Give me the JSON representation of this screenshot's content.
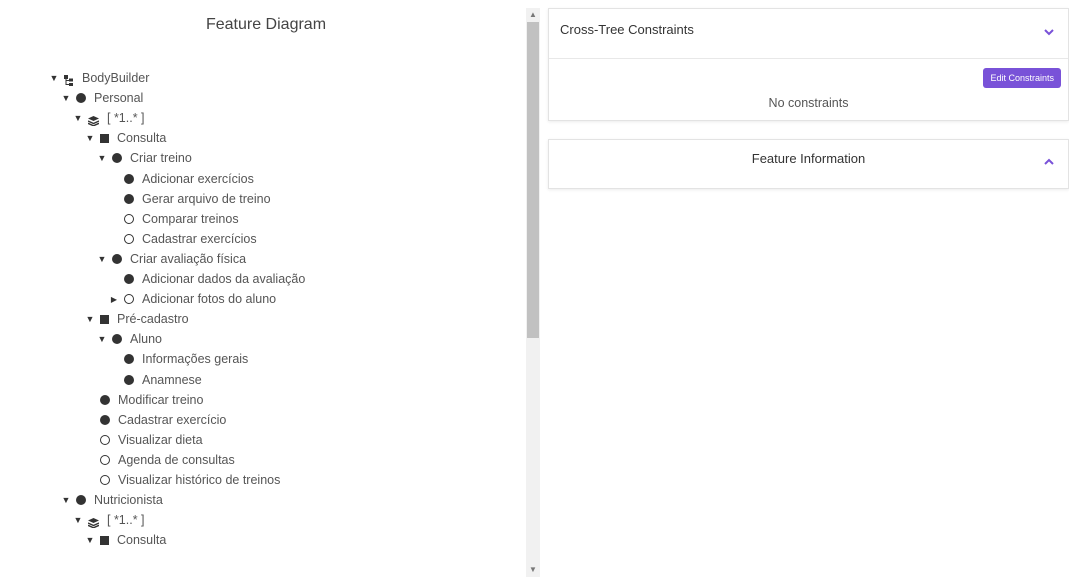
{
  "left_panel": {
    "title": "Feature Diagram",
    "tree": [
      {
        "label": "BodyBuilder",
        "icon": "tree-icon",
        "caret": "down",
        "level": 0
      },
      {
        "label": "Personal",
        "icon": "filled-circle",
        "caret": "down",
        "level": 1
      },
      {
        "label": "[ *1..* ]",
        "icon": "layers-icon",
        "caret": "down",
        "level": 2
      },
      {
        "label": "Consulta",
        "icon": "square",
        "caret": "down",
        "level": 3
      },
      {
        "label": "Criar treino",
        "icon": "filled-circle",
        "caret": "down",
        "level": 4
      },
      {
        "label": "Adicionar exercícios",
        "icon": "filled-circle",
        "caret": "none",
        "level": 5
      },
      {
        "label": "Gerar arquivo de treino",
        "icon": "filled-circle",
        "caret": "none",
        "level": 5
      },
      {
        "label": "Comparar treinos",
        "icon": "hollow-circle",
        "caret": "none",
        "level": 5
      },
      {
        "label": "Cadastrar exercícios",
        "icon": "hollow-circle",
        "caret": "none",
        "level": 5
      },
      {
        "label": "Criar avaliação física",
        "icon": "filled-circle",
        "caret": "down",
        "level": 4
      },
      {
        "label": "Adicionar dados da avaliação",
        "icon": "filled-circle",
        "caret": "none",
        "level": 5
      },
      {
        "label": "Adicionar fotos do aluno",
        "icon": "hollow-circle",
        "caret": "right",
        "level": 5
      },
      {
        "label": "Pré-cadastro",
        "icon": "square",
        "caret": "down",
        "level": 3
      },
      {
        "label": "Aluno",
        "icon": "filled-circle",
        "caret": "down",
        "level": 4
      },
      {
        "label": "Informações gerais",
        "icon": "filled-circle",
        "caret": "none",
        "level": 5
      },
      {
        "label": "Anamnese",
        "icon": "filled-circle",
        "caret": "none",
        "level": 5
      },
      {
        "label": "Modificar treino",
        "icon": "filled-circle",
        "caret": "none",
        "level": 3
      },
      {
        "label": "Cadastrar exercício",
        "icon": "filled-circle",
        "caret": "none",
        "level": 3
      },
      {
        "label": "Visualizar dieta",
        "icon": "hollow-circle",
        "caret": "none",
        "level": 3
      },
      {
        "label": "Agenda de consultas",
        "icon": "hollow-circle",
        "caret": "none",
        "level": 3
      },
      {
        "label": "Visualizar histórico de treinos",
        "icon": "hollow-circle",
        "caret": "none",
        "level": 3
      },
      {
        "label": "Nutricionista",
        "icon": "filled-circle",
        "caret": "down",
        "level": 1
      },
      {
        "label": "[ *1..* ]",
        "icon": "layers-icon",
        "caret": "down",
        "level": 2
      },
      {
        "label": "Consulta",
        "icon": "square",
        "caret": "down",
        "level": 3
      }
    ]
  },
  "constraints_card": {
    "title": "Cross-Tree Constraints",
    "edit_button": "Edit Constraints",
    "empty_text": "No constraints"
  },
  "info_card": {
    "title": "Feature Information"
  },
  "colors": {
    "accent": "#7952d8",
    "icon": "#333333",
    "text": "#555555"
  }
}
